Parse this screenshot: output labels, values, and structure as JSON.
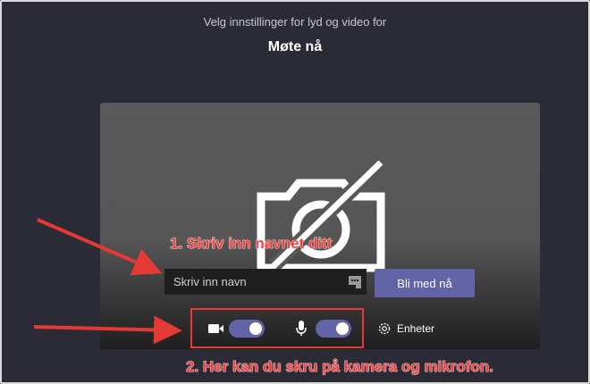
{
  "header": {
    "subtitle": "Velg innstillinger for lyd og video for",
    "meeting_title": "Møte nå"
  },
  "name_field": {
    "placeholder": "Skriv inn navn",
    "value": ""
  },
  "join_button": {
    "label": "Bli med nå"
  },
  "controls": {
    "camera_toggle_on": true,
    "mic_toggle_on": true,
    "devices_label": "Enheter"
  },
  "annotations": {
    "step1": "1. Skriv inn navnet ditt",
    "step2": "2. Her kan du skru på kamera og mikrofon."
  },
  "colors": {
    "background": "#2b2b36",
    "accent": "#6264a7",
    "annotation_red": "#f44040"
  },
  "icons": [
    "camera-off-icon",
    "input-menu-icon",
    "video-camera-icon",
    "microphone-icon",
    "gear-icon"
  ]
}
